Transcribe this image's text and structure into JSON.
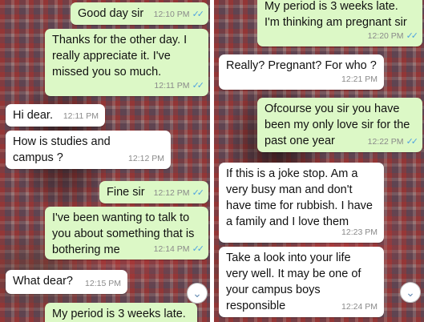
{
  "left_panel": {
    "messages": [
      {
        "text": "Good day sir",
        "time": "12:10 PM",
        "ticks": "✓✓"
      },
      {
        "text": "Thanks for the other day. I really appreciate it. I've missed you so much.",
        "time": "12:11 PM",
        "ticks": "✓✓"
      },
      {
        "text": "Hi dear.",
        "time": "12:11 PM"
      },
      {
        "text": "How is studies and campus ?",
        "time": "12:12 PM"
      },
      {
        "text": "Fine sir",
        "time": "12:12 PM",
        "ticks": "✓✓"
      },
      {
        "text": "I've been wanting to talk to you about something that is bothering me",
        "time": "12:14 PM",
        "ticks": "✓✓"
      },
      {
        "text": "What dear?",
        "time": "12:15 PM"
      },
      {
        "text": "My period is 3 weeks late."
      }
    ],
    "scroll_down_icon": "chevron-down-icon"
  },
  "right_panel": {
    "messages": [
      {
        "text": "My period is 3 weeks late. I'm thinking am pregnant sir",
        "time": "12:20 PM",
        "ticks": "✓✓"
      },
      {
        "text": "Really? Pregnant? For who ?",
        "time": "12:21 PM"
      },
      {
        "text": "Ofcourse you sir you have been my only love sir for the past one year",
        "time": "12:22 PM",
        "ticks": "✓✓"
      },
      {
        "text": "If this is a joke stop. Am a very busy man and don't have time for rubbish. I have a family and I love them",
        "time": "12:23 PM"
      },
      {
        "text": "Take a look into your life very well. It may be one of your campus boys responsible",
        "time": "12:24 PM"
      }
    ],
    "scroll_down_icon": "chevron-down-icon"
  }
}
